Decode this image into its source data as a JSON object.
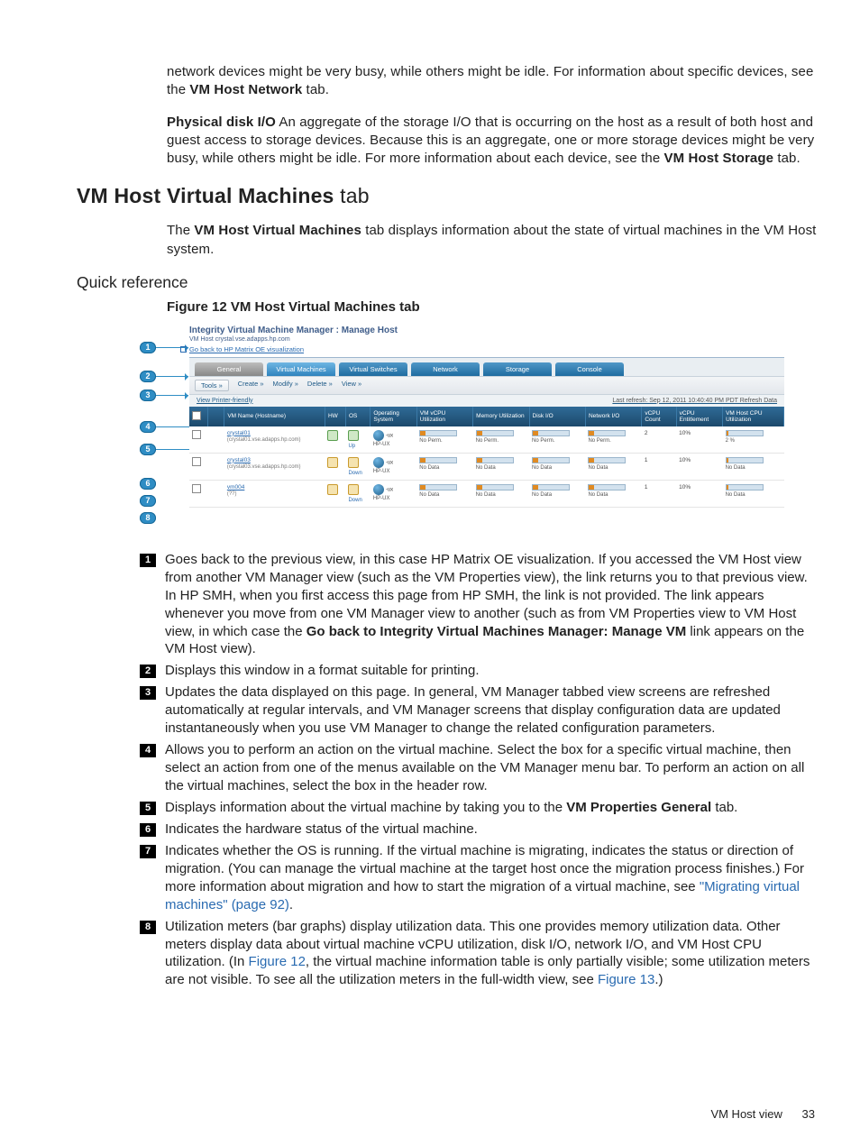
{
  "intro": {
    "para1_pre": "network devices might be very busy, while others might be idle. For information about specific devices, see the ",
    "para1_bold": "VM Host Network",
    "para1_post": " tab.",
    "para2_lead": "Physical disk I/O",
    "para2_body": "  An aggregate of the storage I/O that is occurring on the host as a result of both host and guest access to storage devices. Because this is an aggregate, one or more storage devices might be very busy, while others might be idle. For more information about each device, see the ",
    "para2_bold": "VM Host Storage",
    "para2_post": " tab."
  },
  "section": {
    "title_strong": "VM Host Virtual Machines",
    "title_light": " tab",
    "lead_pre": "The ",
    "lead_bold": "VM Host Virtual Machines",
    "lead_post": " tab displays information about the state of virtual machines in the VM Host system.",
    "quick_ref": "Quick reference",
    "figure_caption": "Figure 12 VM Host Virtual Machines tab"
  },
  "shot": {
    "title": "Integrity Virtual Machine Manager : Manage Host",
    "hostline": "VM Host crystal.vse.adapps.hp.com",
    "goback": "Go back to HP Matrix OE visualization",
    "tabs": [
      "General",
      "Virtual Machines",
      "Virtual Switches",
      "Network",
      "Storage",
      "Console"
    ],
    "toolbar": {
      "tools": "Tools »",
      "menu": [
        "Create »",
        "Modify »",
        "Delete »",
        "View »"
      ]
    },
    "viewer": "View Printer-friendly",
    "refresh_right": "Last refresh: Sep 12, 2011 10:40:40 PM PDT  Refresh Data",
    "headers": [
      "",
      "",
      "VM Name (Hostname)",
      "HW",
      "OS",
      "Operating System",
      "VM vCPU Utilization",
      "Memory Utilization",
      "Disk I/O",
      "Network I/O",
      "vCPU Count",
      "vCPU Entitlement",
      "VM Host CPU Utilization"
    ],
    "rows": [
      {
        "name": "crystal01",
        "host": "(crystal01.vse.adapps.hp.com)",
        "hw": "up",
        "os": "Up",
        "osname": "HP-UX",
        "vcpu": "No Perm.",
        "mem": "No Perm.",
        "disk": "No Perm.",
        "net": "No Perm.",
        "count": "2",
        "ent": "10%",
        "hostcpu": "2 %"
      },
      {
        "name": "crystal03",
        "host": "(crystal03.vse.adapps.hp.com)",
        "hw": "down",
        "os": "Down",
        "osname": "HP-UX",
        "vcpu": "No Data",
        "mem": "No Data",
        "disk": "No Data",
        "net": "No Data",
        "count": "1",
        "ent": "10%",
        "hostcpu": "No Data"
      },
      {
        "name": "vm004",
        "host": "(??)",
        "hw": "down",
        "os": "Down",
        "osname": "HP-UX",
        "vcpu": "No Data",
        "mem": "No Data",
        "disk": "No Data",
        "net": "No Data",
        "count": "1",
        "ent": "10%",
        "hostcpu": "No Data"
      }
    ]
  },
  "callouts": [
    "1",
    "2",
    "3",
    "4",
    "5",
    "6",
    "7",
    "8"
  ],
  "list": {
    "1_pre": "Goes back to the previous view, in this case HP Matrix OE visualization. If you accessed the VM Host view from another VM Manager view (such as the VM Properties view), the link returns you to that previous view. In HP SMH, when you first access this page from HP SMH, the link is not provided. The link appears whenever you move from one VM Manager view to another (such as from VM Properties view to VM Host view, in which case the ",
    "1_bold": "Go back to Integrity Virtual Machines Manager: Manage VM",
    "1_post": " link appears on the VM Host view).",
    "2": "Displays this window in a format suitable for printing.",
    "3": "Updates the data displayed on this page. In general, VM Manager tabbed view screens are refreshed automatically at regular intervals, and VM Manager screens that display configuration data are updated instantaneously when you use VM Manager to change the related configuration parameters.",
    "4": "Allows you to perform an action on the virtual machine. Select the box for a specific virtual machine, then select an action from one of the menus available on the VM Manager menu bar. To perform an action on all the virtual machines, select the box in the header row.",
    "5_pre": "Displays information about the virtual machine by taking you to the ",
    "5_bold": "VM Properties General",
    "5_post": " tab.",
    "6": "Indicates the hardware status of the virtual machine.",
    "7_pre": "Indicates whether the OS is running. If the virtual machine is migrating, indicates the status or direction of migration. (You can manage the virtual machine at the target host once the migration process finishes.) For more information about migration and how to start the migration of a virtual machine, see ",
    "7_link": "\"Migrating virtual machines\" (page 92)",
    "7_post": ".",
    "8_pre": "Utilization meters (bar graphs) display utilization data. This one provides memory utilization data. Other meters display data about virtual machine vCPU utilization, disk I/O, network I/O, and VM Host CPU utilization. (In ",
    "8_link1": "Figure 12",
    "8_mid": ", the virtual machine information table is only partially visible; some utilization meters are not visible. To see all the utilization meters in the full-width view, see ",
    "8_link2": "Figure 13",
    "8_post": ".)"
  },
  "footer": {
    "label": "VM Host view",
    "page": "33"
  }
}
